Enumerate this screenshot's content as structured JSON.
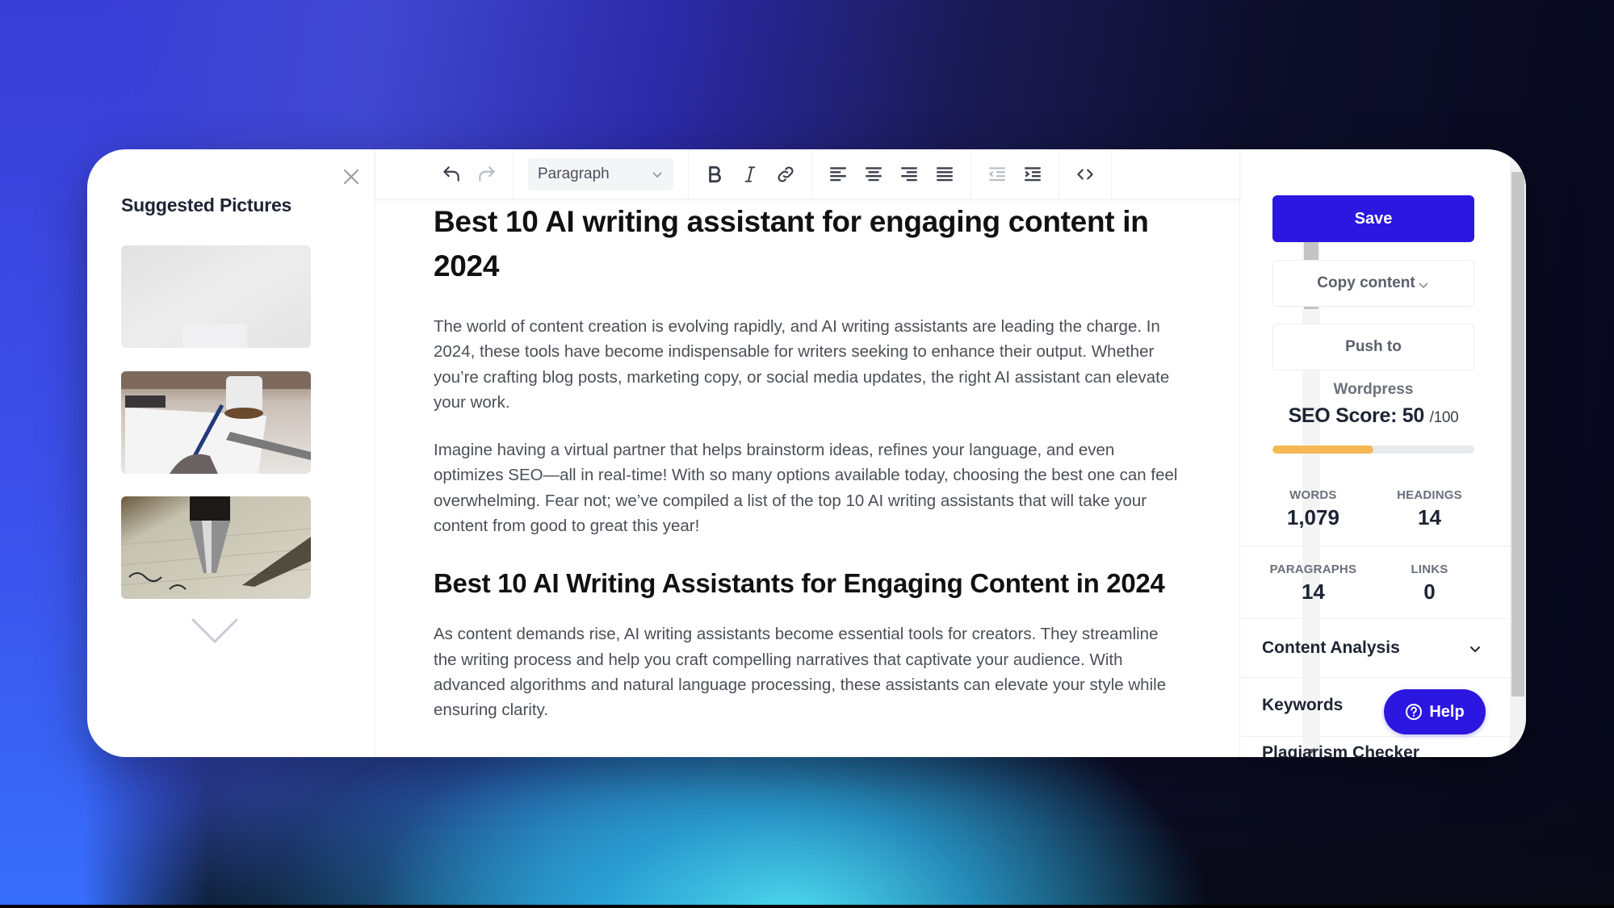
{
  "left_panel": {
    "title": "Suggested Pictures",
    "close_icon": "close-icon",
    "pictures": [
      {
        "alt": "Blank white desk scene"
      },
      {
        "alt": "Hand writing with pen next to coffee mug"
      },
      {
        "alt": "Fountain pen writing on lined paper"
      }
    ],
    "more_icon": "chevron-down-icon"
  },
  "toolbar": {
    "undo": "undo-icon",
    "redo": "redo-icon",
    "block_format": "Paragraph",
    "bold": "bold-icon",
    "italic": "italic-icon",
    "link": "link-icon",
    "align_left": "align-left-icon",
    "align_center": "align-center-icon",
    "align_right": "align-right-icon",
    "align_justify": "align-justify-icon",
    "outdent": "outdent-icon",
    "indent": "indent-icon",
    "source_code": "code-icon"
  },
  "document": {
    "title": "Best 10 AI writing assistant for engaging content in 2024",
    "paragraphs": [
      "The world of content creation is evolving rapidly, and AI writing assistants are leading the charge. In 2024, these tools have become indispensable for writers seeking to enhance their output. Whether you’re crafting blog posts, marketing copy, or social media updates, the right AI assistant can elevate your work.",
      "Imagine having a virtual partner that helps brainstorm ideas, refines your language, and even optimizes SEO—all in real-time! With so many options available today, choosing the best one can feel overwhelming. Fear not; we’ve compiled a list of the top 10 AI writing assistants that will take your content from good to great this year!"
    ],
    "subheading": "Best 10 AI Writing Assistants for Engaging Content in 2024",
    "paragraph_after_subheading": "As content demands rise, AI writing assistants become essential tools for creators. They streamline the writing process and help you craft compelling narratives that captivate your audience. With advanced algorithms and natural language processing, these assistants can elevate your style while ensuring clarity."
  },
  "right_panel": {
    "save_label": "Save",
    "copy_label": "Copy content",
    "push_label": "Push to",
    "push_target": "Wordpress",
    "seo": {
      "label": "SEO Score:",
      "score": "50",
      "max": "/100",
      "progress_percent": 50,
      "bar_color": "#f5b854"
    },
    "stats": {
      "words_label": "WORDS",
      "words_value": "1,079",
      "headings_label": "HEADINGS",
      "headings_value": "14",
      "paragraphs_label": "PARAGRAPHS",
      "paragraphs_value": "14",
      "links_label": "LINKS",
      "links_value": "0"
    },
    "sections": [
      {
        "title": "Content Analysis",
        "expanded": false
      },
      {
        "title": "Keywords"
      },
      {
        "title": "Plagiarism Checker"
      }
    ],
    "help_label": "Help"
  },
  "colors": {
    "primary": "#2b17e0",
    "seo_fill": "#f5b854"
  }
}
